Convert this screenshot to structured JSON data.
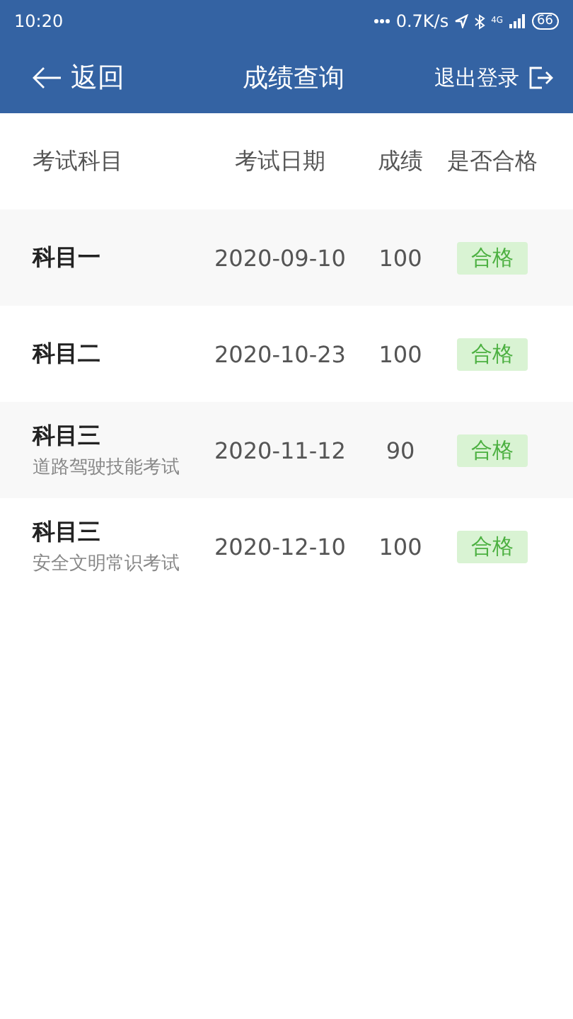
{
  "status_bar": {
    "time": "10:20",
    "speed": "0.7K/s",
    "network": "4G",
    "battery": "66"
  },
  "header": {
    "back": "返回",
    "title": "成绩查询",
    "logout": "退出登录"
  },
  "table": {
    "columns": [
      "考试科目",
      "考试日期",
      "成绩",
      "是否合格"
    ],
    "rows": [
      {
        "subject": "科目一",
        "detail": "",
        "date": "2020-09-10",
        "score": "100",
        "result": "合格",
        "passed": true
      },
      {
        "subject": "科目二",
        "detail": "",
        "date": "2020-10-23",
        "score": "100",
        "result": "合格",
        "passed": true
      },
      {
        "subject": "科目三",
        "detail": "道路驾驶技能考试",
        "date": "2020-11-12",
        "score": "90",
        "result": "合格",
        "passed": true
      },
      {
        "subject": "科目三",
        "detail": "安全文明常识考试",
        "date": "2020-12-10",
        "score": "100",
        "result": "合格",
        "passed": true
      }
    ]
  }
}
